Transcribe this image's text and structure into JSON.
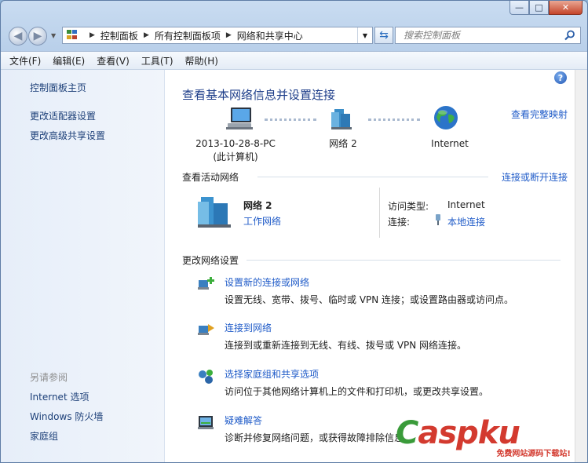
{
  "window": {
    "caption": {
      "min": "—",
      "max": "□",
      "close": "✕"
    }
  },
  "address": {
    "crumbs": [
      "控制面板",
      "所有控制面板项",
      "网络和共享中心"
    ],
    "search_placeholder": "搜索控制面板"
  },
  "menubar": {
    "items": [
      "文件(F)",
      "编辑(E)",
      "查看(V)",
      "工具(T)",
      "帮助(H)"
    ]
  },
  "sidebar": {
    "links": [
      "控制面板主页",
      "更改适配器设置",
      "更改高级共享设置"
    ],
    "see_also_title": "另请参阅",
    "see_also": [
      "Internet 选项",
      "Windows 防火墙",
      "家庭组"
    ]
  },
  "main": {
    "title": "查看基本网络信息并设置连接",
    "view_full_map": "查看完整映射",
    "map": {
      "computer": [
        "2013-10-28-8-PC",
        "(此计算机)"
      ],
      "network": "网络  2",
      "internet": "Internet"
    },
    "active": {
      "header": "查看活动网络",
      "connect_link": "连接或断开连接",
      "network_name": "网络  2",
      "network_type": "工作网络",
      "access_type_label": "访问类型:",
      "access_type_value": "Internet",
      "connections_label": "连接:",
      "connections_value": "本地连接"
    },
    "change": {
      "header": "更改网络设置",
      "tasks": [
        {
          "title": "设置新的连接或网络",
          "desc": "设置无线、宽带、拨号、临时或 VPN 连接；或设置路由器或访问点。"
        },
        {
          "title": "连接到网络",
          "desc": "连接到或重新连接到无线、有线、拨号或 VPN 网络连接。"
        },
        {
          "title": "选择家庭组和共享选项",
          "desc": "访问位于其他网络计算机上的文件和打印机，或更改共享设置。"
        },
        {
          "title": "疑难解答",
          "desc": "诊断并修复网络问题，或获得故障排除信息。"
        }
      ]
    }
  },
  "watermark": {
    "logo_text": "aspku",
    "sub_text": "免费网站源码下载站!"
  },
  "colors": {
    "link": "#1f5bc8",
    "title": "#1e3e8a",
    "sidebar_link": "#1c3f78"
  }
}
